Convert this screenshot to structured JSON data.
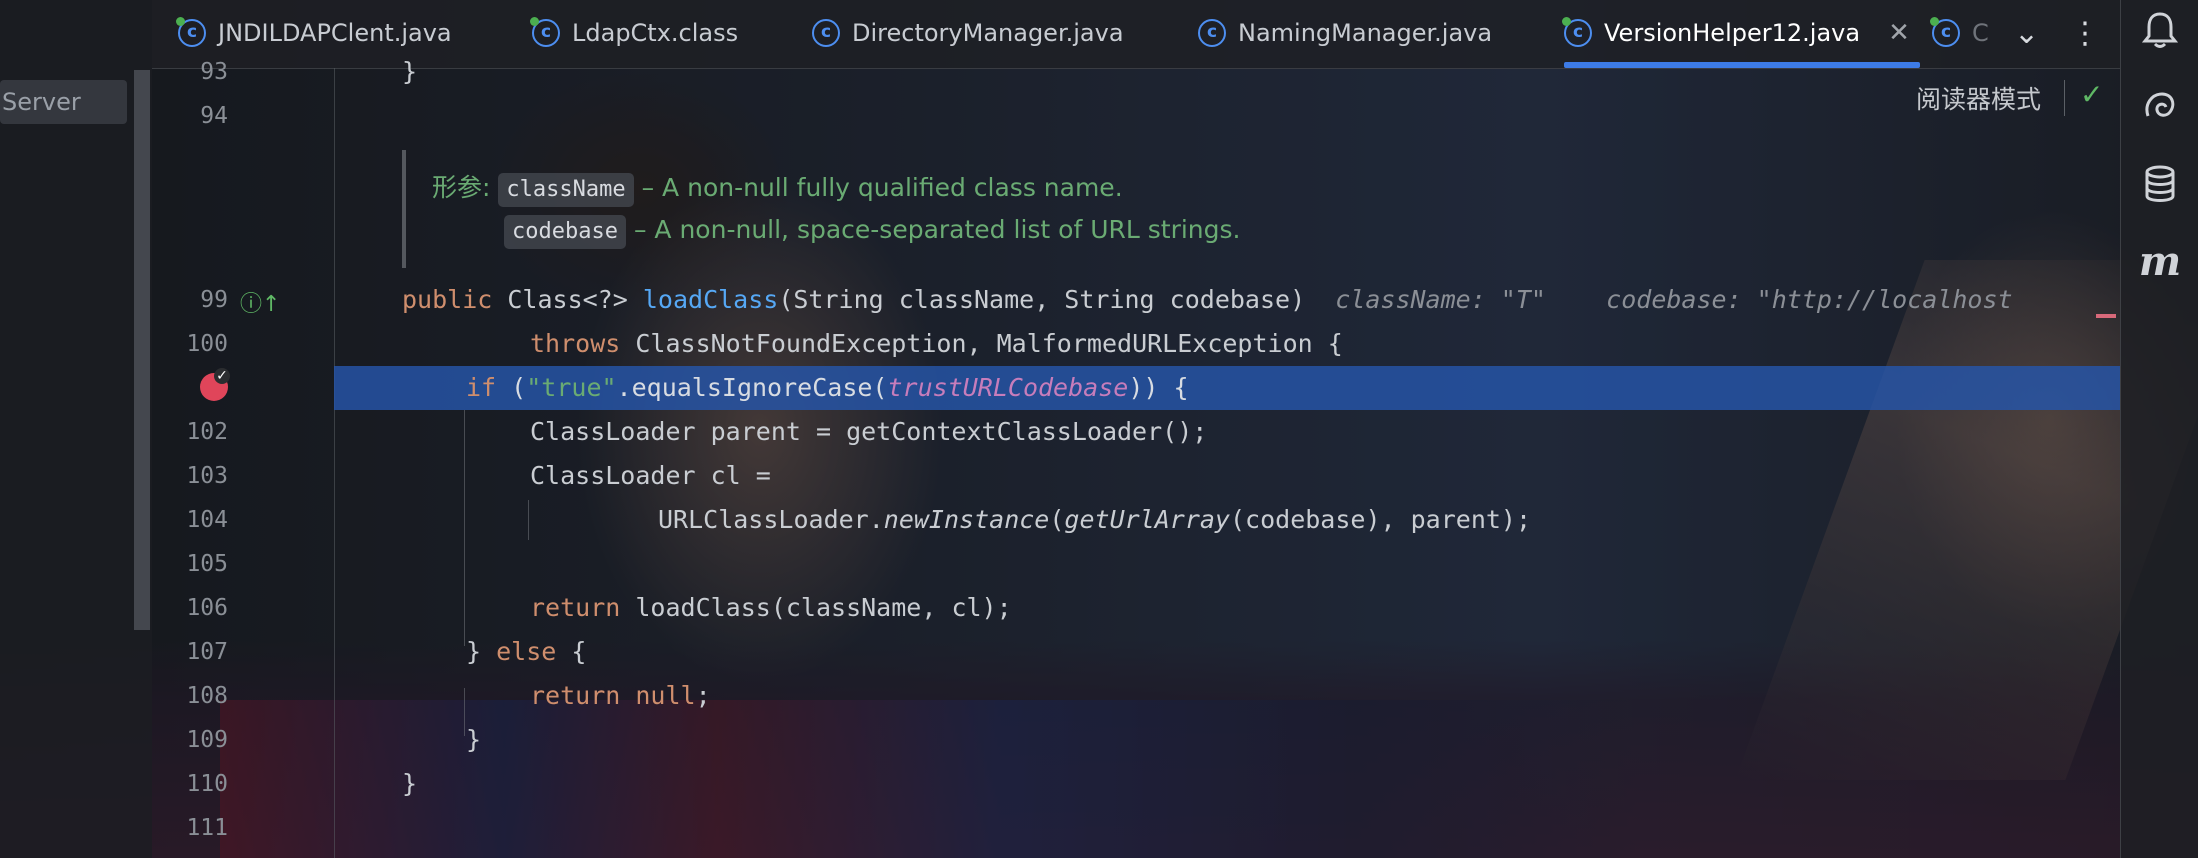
{
  "left_panel": {
    "item_label": "Server"
  },
  "tabs": [
    {
      "label": "JNDILDAPClent.java",
      "icon": "class-icon",
      "modified": true,
      "active": false
    },
    {
      "label": "LdapCtx.class",
      "icon": "class-icon",
      "modified": true,
      "active": false
    },
    {
      "label": "DirectoryManager.java",
      "icon": "class-icon",
      "modified": false,
      "active": false
    },
    {
      "label": "NamingManager.java",
      "icon": "class-icon",
      "modified": false,
      "active": false
    },
    {
      "label": "VersionHelper12.java",
      "icon": "class-icon",
      "modified": true,
      "active": true
    },
    {
      "label": "C",
      "icon": "class-icon",
      "modified": true,
      "active": false
    }
  ],
  "tab_tools": {
    "dropdown": "⌄",
    "more": "⋮",
    "close": "✕"
  },
  "reader_mode": {
    "label": "阅读器模式",
    "status": "✓"
  },
  "line_numbers": [
    "93",
    "94",
    "99",
    "100",
    "102",
    "103",
    "104",
    "105",
    "106",
    "107",
    "108",
    "109",
    "110",
    "111"
  ],
  "javadoc": {
    "tag": "形参:",
    "params": [
      {
        "name": "className",
        "desc": "– A non-null fully qualified class name."
      },
      {
        "name": "codebase",
        "desc": "– A non-null, space-separated list of URL strings."
      }
    ]
  },
  "code": {
    "l93": "}",
    "l99": {
      "kw": "public",
      "type": "Class<?>",
      "name": "loadClass",
      "params": "(String className, String codebase)",
      "hint1": "className: \"T\"",
      "hint2": "codebase: \"http://localhost"
    },
    "l100": {
      "kw": "throws",
      "rest": "ClassNotFoundException, MalformedURLException {"
    },
    "l101": {
      "kw": "if",
      "p1": "(",
      "str": "\"true\"",
      "p2": ".equalsIgnoreCase(",
      "field": "trustURLCodebase",
      "p3": ")) {"
    },
    "l102": "ClassLoader parent = getContextClassLoader();",
    "l103": "ClassLoader cl =",
    "l104": {
      "p1": "URLClassLoader.",
      "m1": "newInstance",
      "p2": "(",
      "m2": "getUrlArray",
      "p3": "(codebase), parent);"
    },
    "l106": {
      "kw": "return",
      "rest": " loadClass(className, cl);"
    },
    "l107": {
      "p1": "} ",
      "kw": "else",
      "p2": " {"
    },
    "l108": {
      "kw": "return",
      "kw2": "null",
      "p": ";"
    },
    "l109": "}",
    "l110": "}"
  },
  "right_strip": {
    "icon_m": "m"
  },
  "colors": {
    "accent": "#3d7be6",
    "selection": "#2656aa",
    "keyword": "#cf8e6d",
    "string": "#6aab73",
    "function": "#56a8f5",
    "field": "#c77dbb"
  }
}
